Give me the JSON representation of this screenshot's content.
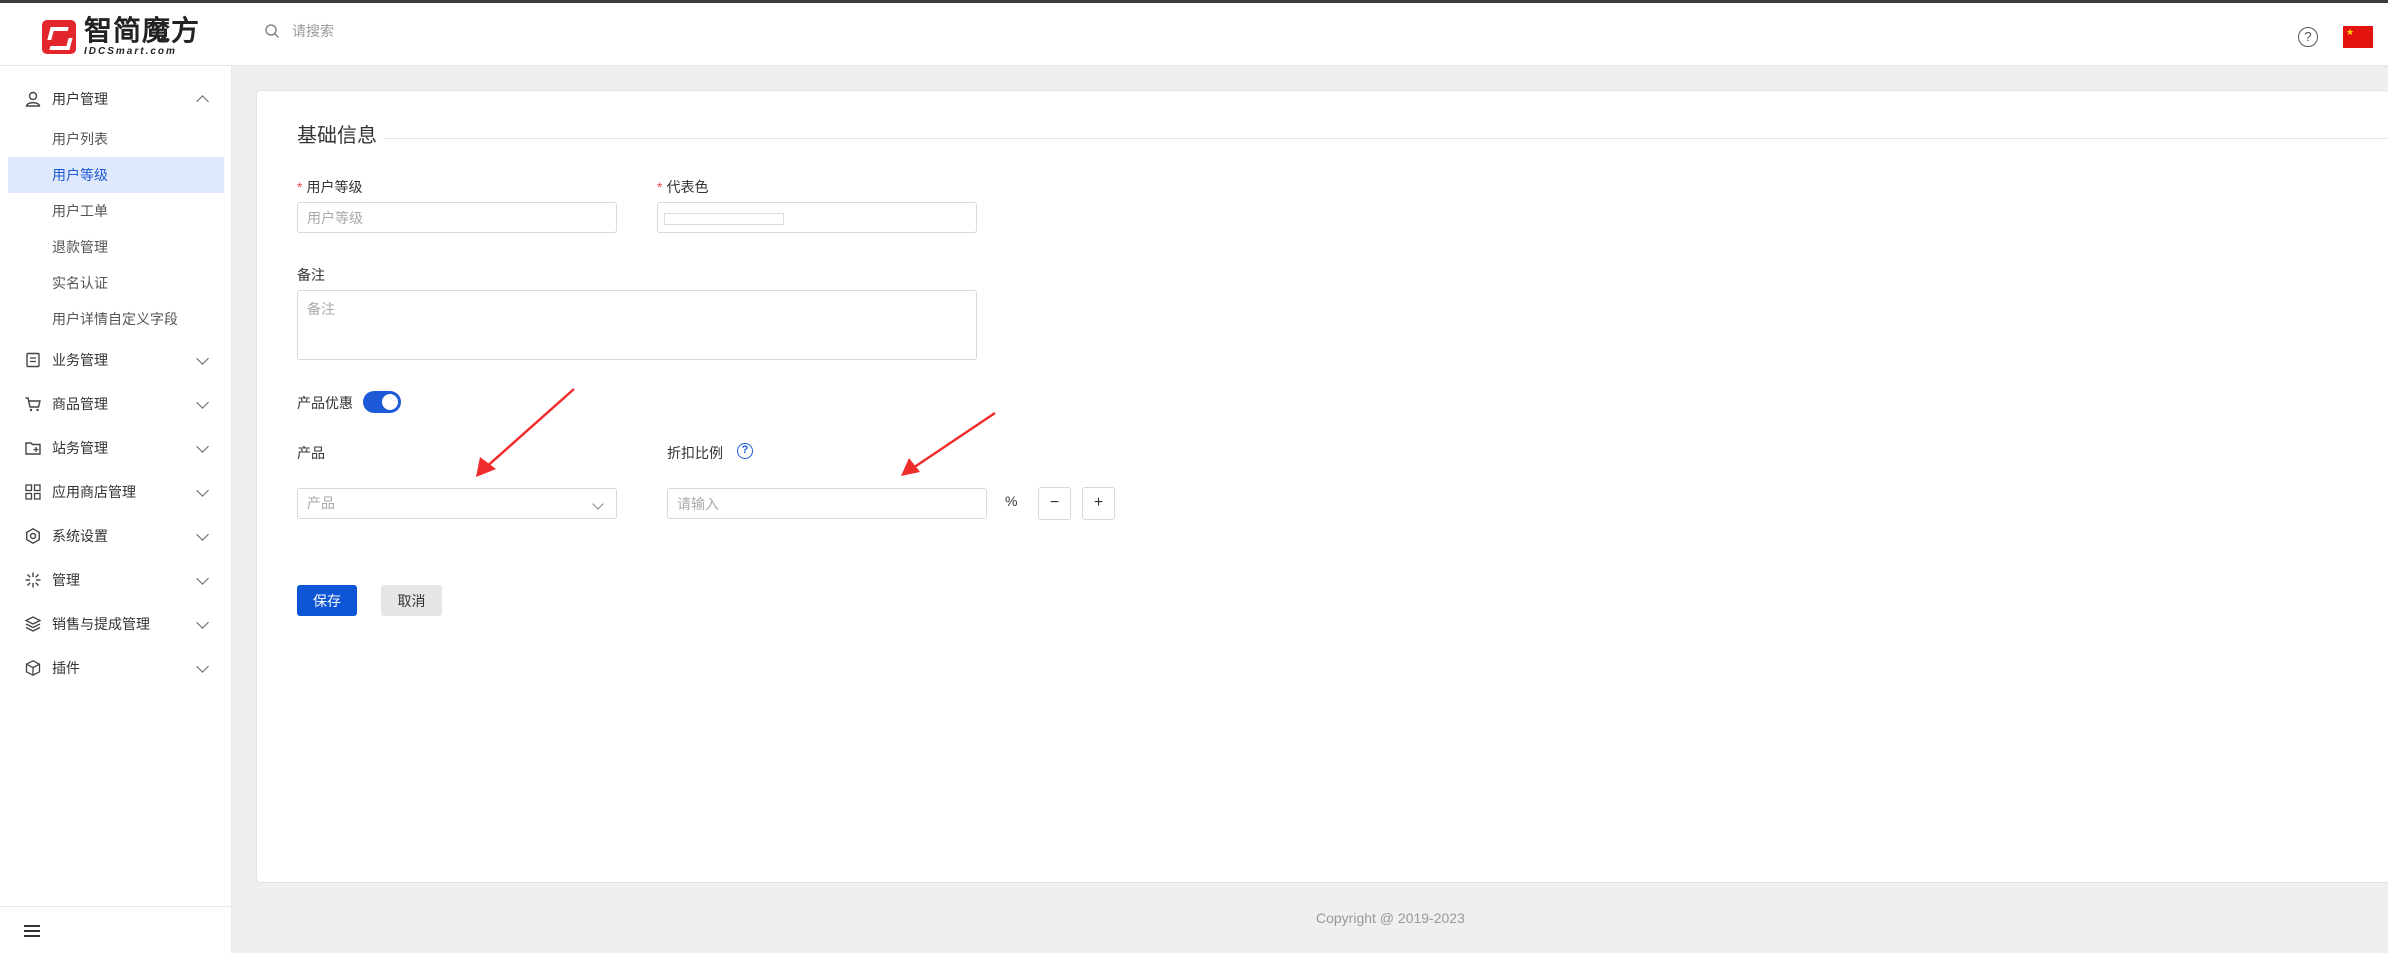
{
  "header": {
    "logo_cn": "智简魔方",
    "logo_en": "IDCSmart.com",
    "search_placeholder": "请搜索",
    "help_icon": "question-circle-icon",
    "language_flag": "china-flag-icon"
  },
  "sidebar": {
    "groups": [
      {
        "label": "用户管理",
        "icon": "user-icon",
        "expanded": true
      },
      {
        "label": "业务管理",
        "icon": "document-list-icon"
      },
      {
        "label": "商品管理",
        "icon": "cart-icon"
      },
      {
        "label": "站务管理",
        "icon": "folder-add-icon"
      },
      {
        "label": "应用商店管理",
        "icon": "grid-apps-icon"
      },
      {
        "label": "系统设置",
        "icon": "settings-hex-icon"
      },
      {
        "label": "管理",
        "icon": "sparkle-icon"
      },
      {
        "label": "销售与提成管理",
        "icon": "layers-icon"
      },
      {
        "label": "插件",
        "icon": "cube-icon"
      }
    ],
    "sub_items": [
      "用户列表",
      "用户等级",
      "用户工单",
      "退款管理",
      "实名认证",
      "用户详情自定义字段"
    ],
    "active_sub_item": "用户等级"
  },
  "form": {
    "section_title": "基础信息",
    "user_level_label": "用户等级",
    "user_level_placeholder": "用户等级",
    "color_label": "代表色",
    "note_label": "备注",
    "note_placeholder": "备注",
    "product_discount_label": "产品优惠",
    "product_discount_enabled": true,
    "product_label": "产品",
    "product_placeholder": "产品",
    "discount_ratio_label": "折扣比例",
    "discount_ratio_placeholder": "请输入",
    "percent_symbol": "%",
    "minus": "−",
    "plus": "+",
    "save": "保存",
    "cancel": "取消",
    "accent_color": "#0b55d6",
    "annotation_arrow_color": "#f02c2c"
  },
  "footer": {
    "copyright": "Copyright @ 2019-2023"
  }
}
